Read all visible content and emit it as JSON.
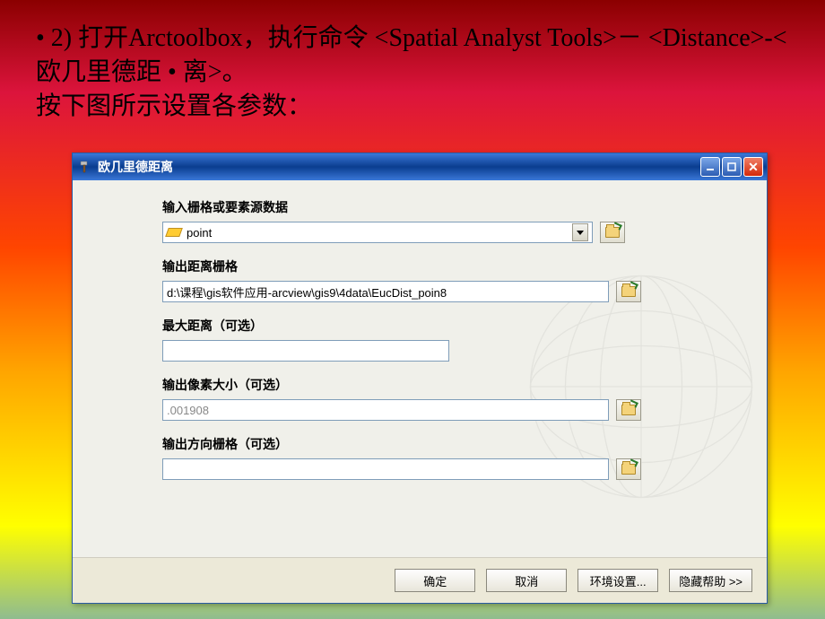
{
  "slide": {
    "line1": "• 2) 打开Arctoolbox，执行命令 <Spatial Analyst Tools>－ <Distance>-<欧几里德距 • 离>。",
    "line2": "按下图所示设置各参数："
  },
  "dialog": {
    "title": "欧几里德距离",
    "fields": {
      "source": {
        "label": "输入栅格或要素源数据",
        "value": "point"
      },
      "output_distance": {
        "label": "输出距离栅格",
        "value": "d:\\课程\\gis软件应用-arcview\\gis9\\4data\\EucDist_poin8"
      },
      "max_distance": {
        "label": "最大距离（可选）",
        "value": ""
      },
      "cell_size": {
        "label": "输出像素大小（可选）",
        "value": ".001908"
      },
      "output_direction": {
        "label": "输出方向栅格（可选）",
        "value": ""
      }
    },
    "buttons": {
      "ok": "确定",
      "cancel": "取消",
      "env": "环境设置...",
      "hide_help": "隐藏帮助 >>"
    }
  }
}
